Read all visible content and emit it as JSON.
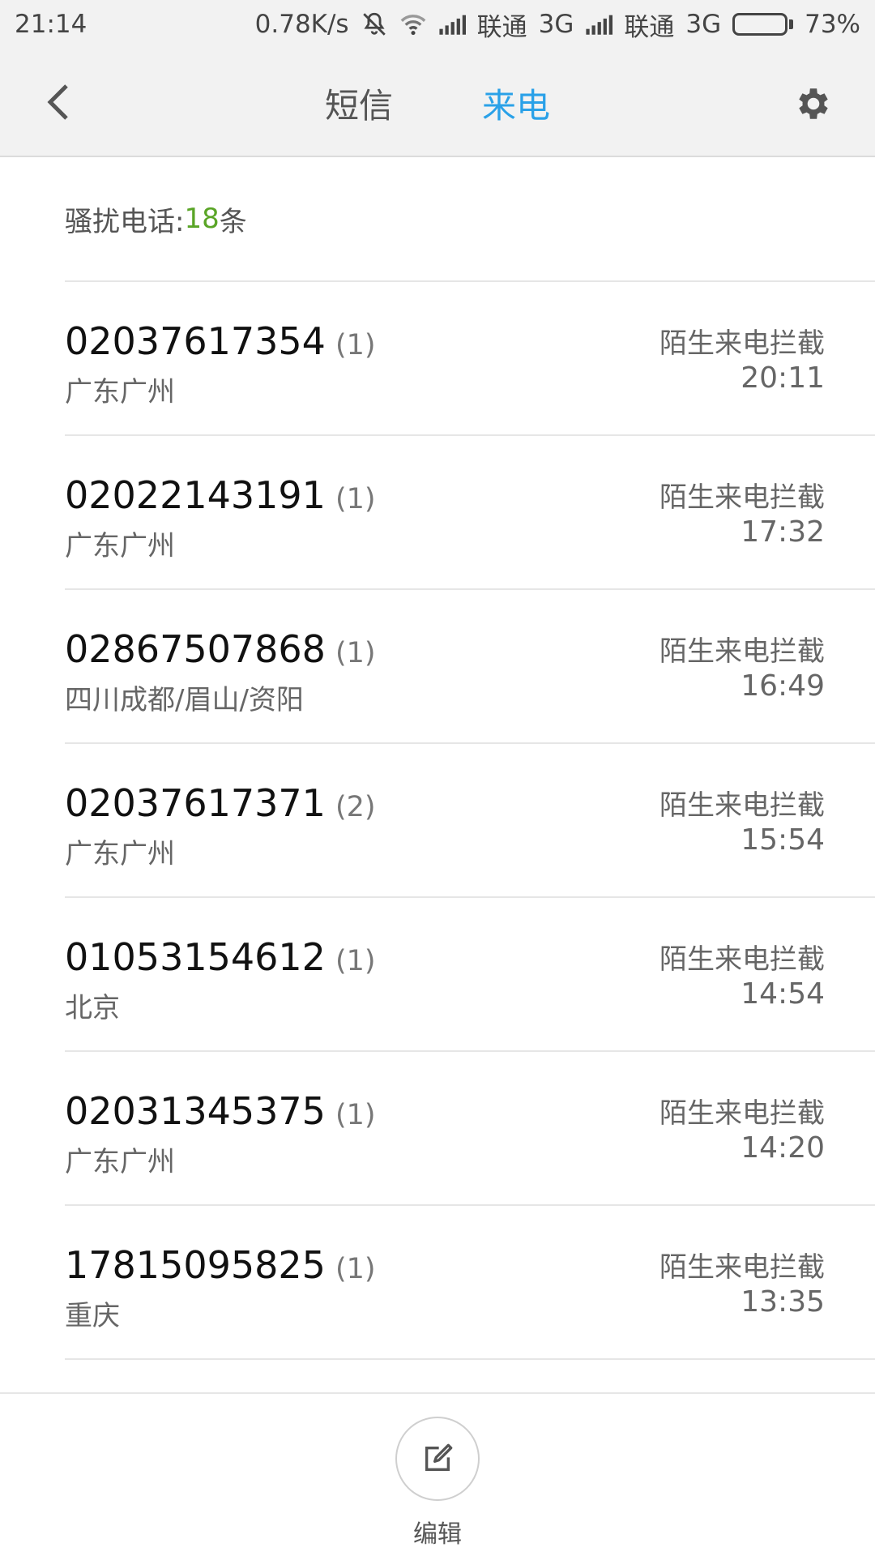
{
  "statusbar": {
    "time": "21:14",
    "speed": "0.78K/s",
    "carrier1": "联通",
    "net1": "3G",
    "carrier2": "联通",
    "net2": "3G",
    "battery": "73%",
    "battery_level": 0.73,
    "icons": [
      "silent-icon",
      "wifi-icon",
      "signal-icon",
      "signal-icon",
      "battery-icon"
    ]
  },
  "header": {
    "tab_sms": "短信",
    "tab_calls": "来电",
    "active_tab": "来电",
    "accent_color": "#2aa1e8",
    "icons": [
      "back-chevron-icon",
      "gear-icon"
    ]
  },
  "summary": {
    "prefix": "骚扰电话:",
    "count": "18",
    "suffix": "条",
    "count_color": "#5aa527"
  },
  "calls": [
    {
      "number": "02037617354",
      "count": "(1)",
      "location": "广东广州",
      "label": "陌生来电拦截",
      "time": "20:11"
    },
    {
      "number": "02022143191",
      "count": "(1)",
      "location": "广东广州",
      "label": "陌生来电拦截",
      "time": "17:32"
    },
    {
      "number": "02867507868",
      "count": "(1)",
      "location": "四川成都/眉山/资阳",
      "label": "陌生来电拦截",
      "time": "16:49"
    },
    {
      "number": "02037617371",
      "count": "(2)",
      "location": "广东广州",
      "label": "陌生来电拦截",
      "time": "15:54"
    },
    {
      "number": "01053154612",
      "count": "(1)",
      "location": "北京",
      "label": "陌生来电拦截",
      "time": "14:54"
    },
    {
      "number": "02031345375",
      "count": "(1)",
      "location": "广东广州",
      "label": "陌生来电拦截",
      "time": "14:20"
    },
    {
      "number": "17815095825",
      "count": "(1)",
      "location": "重庆",
      "label": "陌生来电拦截",
      "time": "13:35"
    }
  ],
  "bottombar": {
    "edit_label": "编辑",
    "icon": "edit-icon"
  }
}
